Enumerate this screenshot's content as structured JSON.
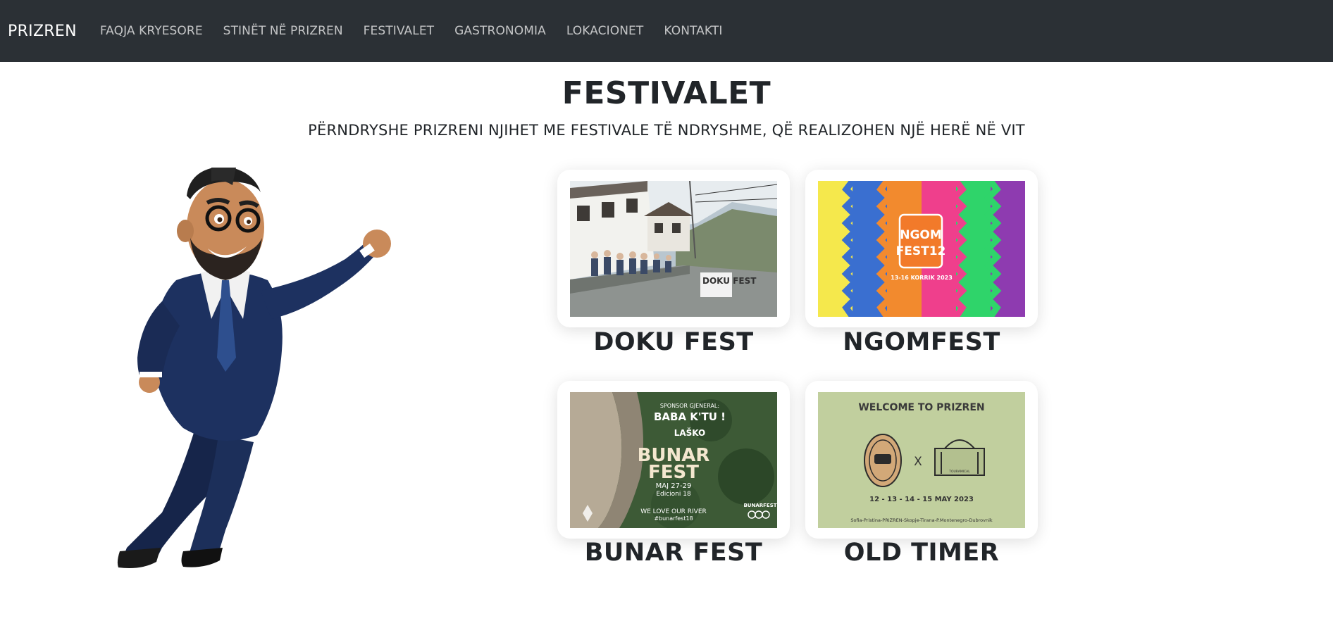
{
  "navbar": {
    "brand": "PRIZREN",
    "items": [
      {
        "label": "FAQJA KRYESORE"
      },
      {
        "label": "STINËT NË PRIZREN"
      },
      {
        "label": "FESTIVALET"
      },
      {
        "label": "GASTRONOMIA"
      },
      {
        "label": "LOKACIONET"
      },
      {
        "label": "KONTAKTI"
      }
    ]
  },
  "main": {
    "title": "FESTIVALET",
    "subtitle": "PËRNDRYSHE PRIZRENI NJIHET ME FESTIVALE TË NDRYSHME, QË REALIZOHEN NJË HERË NË VIT"
  },
  "festivals": [
    {
      "title": "DOKU FEST",
      "sign_text": "DOKU FEST"
    },
    {
      "title": "NGOMFEST",
      "logo_line1": "NGOM",
      "logo_line2": "FEST12",
      "dates": "13-16 KORRIK 2023"
    },
    {
      "title": "BUNAR FEST",
      "sponsor_label": "SPONSOR GJENERAL:",
      "sponsor": "BABA K'TU !",
      "brand": "LAŠKO",
      "name_line1": "BUNAR",
      "name_line2": "FEST",
      "dates": "MAJ 27-29",
      "edition": "Edicioni 18",
      "slogan": "WE LOVE OUR RIVER",
      "hashtag": "#bunarfest18",
      "corner_logo": "BUNARFEST"
    },
    {
      "title": "OLD TIMER",
      "welcome": "WELCOME TO PRIZREN",
      "x_mark": "X",
      "badge_text": "TOURAMICAL",
      "dates": "12 - 13 - 14 - 15 MAY 2023",
      "route": "Sofia-Pristina-PRIZREN-Skopje-Tirana-P.Montenegro-Dubrovnik"
    }
  ],
  "colors": {
    "navbar_bg": "#2b3035",
    "text": "#212529",
    "oldtimer_bg": "#c1cf9e",
    "ngom_stripes": [
      "#f5e84c",
      "#3a6fd0",
      "#f28a2e",
      "#ef3f8c",
      "#2fd46a",
      "#8e3bb0"
    ]
  }
}
